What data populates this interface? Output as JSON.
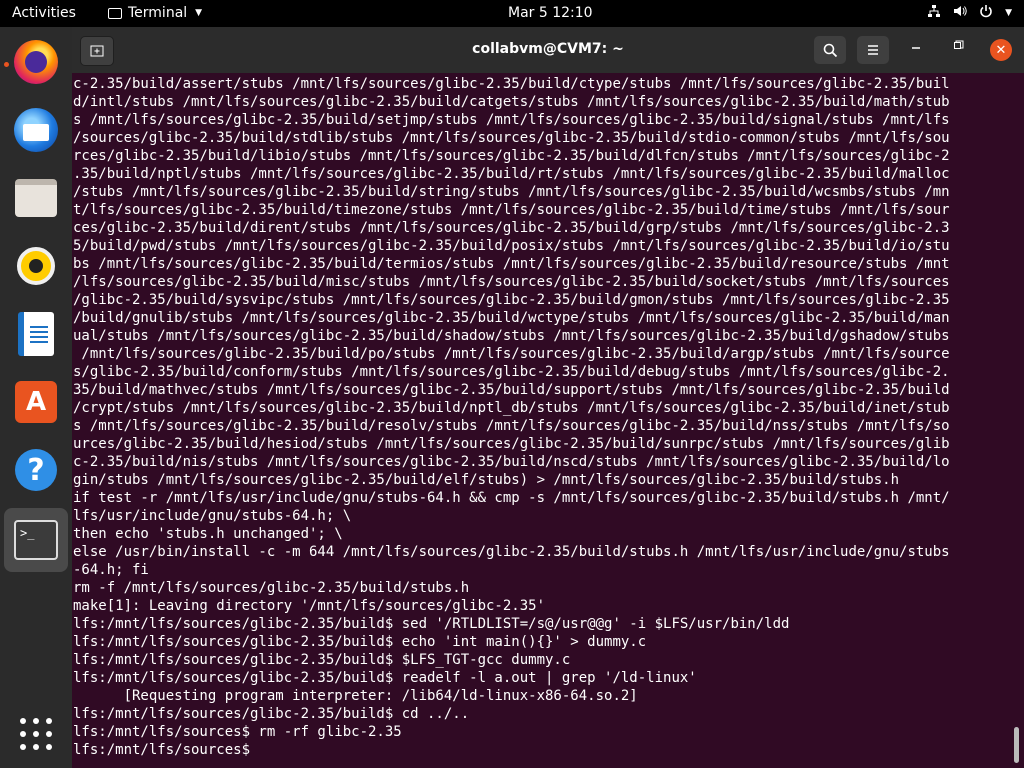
{
  "topbar": {
    "activities": "Activities",
    "app_name": "Terminal",
    "clock": "Mar 5  12:10"
  },
  "dock": {
    "items": [
      "firefox-icon",
      "thunderbird-icon",
      "files-icon",
      "rhythmbox-icon",
      "libreoffice-writer-icon",
      "ubuntu-software-icon",
      "help-icon",
      "terminal-icon",
      "show-applications-icon"
    ]
  },
  "window": {
    "title": "collabvm@CVM7: ~"
  },
  "terminal": {
    "lines": [
      "c-2.35/build/assert/stubs /mnt/lfs/sources/glibc-2.35/build/ctype/stubs /mnt/lfs/sources/glibc-2.35/buil",
      "d/intl/stubs /mnt/lfs/sources/glibc-2.35/build/catgets/stubs /mnt/lfs/sources/glibc-2.35/build/math/stub",
      "s /mnt/lfs/sources/glibc-2.35/build/setjmp/stubs /mnt/lfs/sources/glibc-2.35/build/signal/stubs /mnt/lfs",
      "/sources/glibc-2.35/build/stdlib/stubs /mnt/lfs/sources/glibc-2.35/build/stdio-common/stubs /mnt/lfs/sou",
      "rces/glibc-2.35/build/libio/stubs /mnt/lfs/sources/glibc-2.35/build/dlfcn/stubs /mnt/lfs/sources/glibc-2",
      ".35/build/nptl/stubs /mnt/lfs/sources/glibc-2.35/build/rt/stubs /mnt/lfs/sources/glibc-2.35/build/malloc",
      "/stubs /mnt/lfs/sources/glibc-2.35/build/string/stubs /mnt/lfs/sources/glibc-2.35/build/wcsmbs/stubs /mn",
      "t/lfs/sources/glibc-2.35/build/timezone/stubs /mnt/lfs/sources/glibc-2.35/build/time/stubs /mnt/lfs/sour",
      "ces/glibc-2.35/build/dirent/stubs /mnt/lfs/sources/glibc-2.35/build/grp/stubs /mnt/lfs/sources/glibc-2.3",
      "5/build/pwd/stubs /mnt/lfs/sources/glibc-2.35/build/posix/stubs /mnt/lfs/sources/glibc-2.35/build/io/stu",
      "bs /mnt/lfs/sources/glibc-2.35/build/termios/stubs /mnt/lfs/sources/glibc-2.35/build/resource/stubs /mnt",
      "/lfs/sources/glibc-2.35/build/misc/stubs /mnt/lfs/sources/glibc-2.35/build/socket/stubs /mnt/lfs/sources",
      "/glibc-2.35/build/sysvipc/stubs /mnt/lfs/sources/glibc-2.35/build/gmon/stubs /mnt/lfs/sources/glibc-2.35",
      "/build/gnulib/stubs /mnt/lfs/sources/glibc-2.35/build/wctype/stubs /mnt/lfs/sources/glibc-2.35/build/man",
      "ual/stubs /mnt/lfs/sources/glibc-2.35/build/shadow/stubs /mnt/lfs/sources/glibc-2.35/build/gshadow/stubs",
      " /mnt/lfs/sources/glibc-2.35/build/po/stubs /mnt/lfs/sources/glibc-2.35/build/argp/stubs /mnt/lfs/source",
      "s/glibc-2.35/build/conform/stubs /mnt/lfs/sources/glibc-2.35/build/debug/stubs /mnt/lfs/sources/glibc-2.",
      "35/build/mathvec/stubs /mnt/lfs/sources/glibc-2.35/build/support/stubs /mnt/lfs/sources/glibc-2.35/build",
      "/crypt/stubs /mnt/lfs/sources/glibc-2.35/build/nptl_db/stubs /mnt/lfs/sources/glibc-2.35/build/inet/stub",
      "s /mnt/lfs/sources/glibc-2.35/build/resolv/stubs /mnt/lfs/sources/glibc-2.35/build/nss/stubs /mnt/lfs/so",
      "urces/glibc-2.35/build/hesiod/stubs /mnt/lfs/sources/glibc-2.35/build/sunrpc/stubs /mnt/lfs/sources/glib",
      "c-2.35/build/nis/stubs /mnt/lfs/sources/glibc-2.35/build/nscd/stubs /mnt/lfs/sources/glibc-2.35/build/lo",
      "gin/stubs /mnt/lfs/sources/glibc-2.35/build/elf/stubs) > /mnt/lfs/sources/glibc-2.35/build/stubs.h",
      "if test -r /mnt/lfs/usr/include/gnu/stubs-64.h && cmp -s /mnt/lfs/sources/glibc-2.35/build/stubs.h /mnt/",
      "lfs/usr/include/gnu/stubs-64.h; \\",
      "then echo 'stubs.h unchanged'; \\",
      "else /usr/bin/install -c -m 644 /mnt/lfs/sources/glibc-2.35/build/stubs.h /mnt/lfs/usr/include/gnu/stubs",
      "-64.h; fi",
      "rm -f /mnt/lfs/sources/glibc-2.35/build/stubs.h",
      "make[1]: Leaving directory '/mnt/lfs/sources/glibc-2.35'",
      "lfs:/mnt/lfs/sources/glibc-2.35/build$ sed '/RTLDLIST=/s@/usr@@g' -i $LFS/usr/bin/ldd",
      "lfs:/mnt/lfs/sources/glibc-2.35/build$ echo 'int main(){}' > dummy.c",
      "lfs:/mnt/lfs/sources/glibc-2.35/build$ $LFS_TGT-gcc dummy.c",
      "lfs:/mnt/lfs/sources/glibc-2.35/build$ readelf -l a.out | grep '/ld-linux'",
      "      [Requesting program interpreter: /lib64/ld-linux-x86-64.so.2]",
      "lfs:/mnt/lfs/sources/glibc-2.35/build$ cd ../..",
      "lfs:/mnt/lfs/sources$ rm -rf glibc-2.35",
      "lfs:/mnt/lfs/sources$ "
    ]
  }
}
